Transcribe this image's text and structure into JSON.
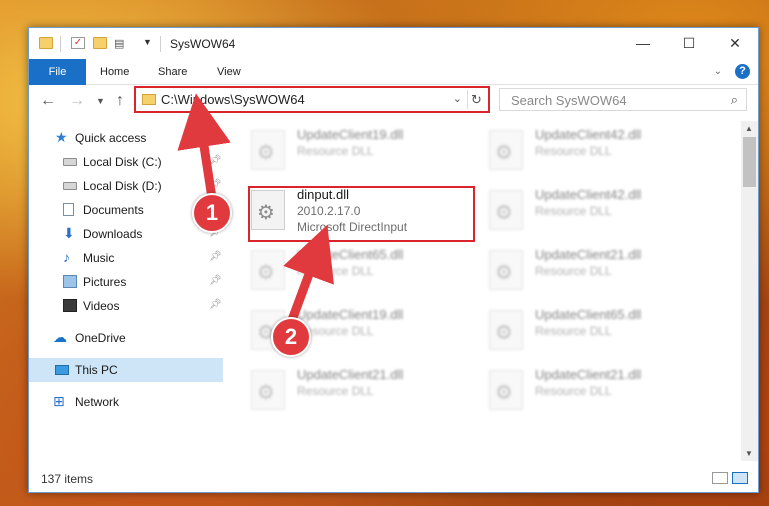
{
  "window": {
    "title": "SysWOW64",
    "controls": {
      "minimize": "—",
      "maximize": "☐",
      "close": "✕"
    }
  },
  "ribbon": {
    "file_tab": "File",
    "tabs": [
      "Home",
      "Share",
      "View"
    ],
    "help": "?"
  },
  "address_bar": {
    "path": "C:\\Windows\\SysWOW64"
  },
  "search": {
    "placeholder": "Search SysWOW64"
  },
  "sidebar": {
    "items": [
      {
        "label": "Quick access",
        "icon": "star-icon",
        "pinned": false
      },
      {
        "label": "Local Disk (C:)",
        "icon": "drive-icon",
        "pinned": true
      },
      {
        "label": "Local Disk (D:)",
        "icon": "drive-icon",
        "pinned": true
      },
      {
        "label": "Documents",
        "icon": "documents-icon",
        "pinned": true
      },
      {
        "label": "Downloads",
        "icon": "downloads-icon",
        "pinned": true
      },
      {
        "label": "Music",
        "icon": "music-icon",
        "pinned": true
      },
      {
        "label": "Pictures",
        "icon": "pictures-icon",
        "pinned": true
      },
      {
        "label": "Videos",
        "icon": "videos-icon",
        "pinned": true
      },
      {
        "label": "OneDrive",
        "icon": "cloud-icon",
        "pinned": false
      },
      {
        "label": "This PC",
        "icon": "computer-icon",
        "pinned": false,
        "selected": true
      },
      {
        "label": "Network",
        "icon": "network-icon",
        "pinned": false
      }
    ]
  },
  "files": [
    {
      "name": "UpdateClient19.dll",
      "line1": "Resource DLL",
      "line2": ""
    },
    {
      "name": "UpdateClient42.dll",
      "line1": "Resource DLL",
      "line2": ""
    },
    {
      "name": "dinput.dll",
      "line1": "2010.2.17.0",
      "line2": "Microsoft DirectInput"
    },
    {
      "name": "UpdateClient42.dll",
      "line1": "Resource DLL",
      "line2": ""
    },
    {
      "name": "UpdateClient65.dll",
      "line1": "Resource DLL",
      "line2": ""
    },
    {
      "name": "UpdateClient21.dll",
      "line1": "Resource DLL",
      "line2": ""
    },
    {
      "name": "UpdateClient19.dll",
      "line1": "Resource DLL",
      "line2": ""
    },
    {
      "name": "UpdateClient65.dll",
      "line1": "Resource DLL",
      "line2": ""
    },
    {
      "name": "UpdateClient21.dll",
      "line1": "Resource DLL",
      "line2": ""
    },
    {
      "name": "UpdateClient21.dll",
      "line1": "Resource DLL",
      "line2": ""
    }
  ],
  "status": {
    "item_count": "137 items"
  },
  "callouts": {
    "one": "1",
    "two": "2"
  },
  "colors": {
    "accent": "#1a6fc6",
    "highlight_border": "#d8242a",
    "callout": "#e0393e",
    "selected_bg": "#cde5f7"
  }
}
